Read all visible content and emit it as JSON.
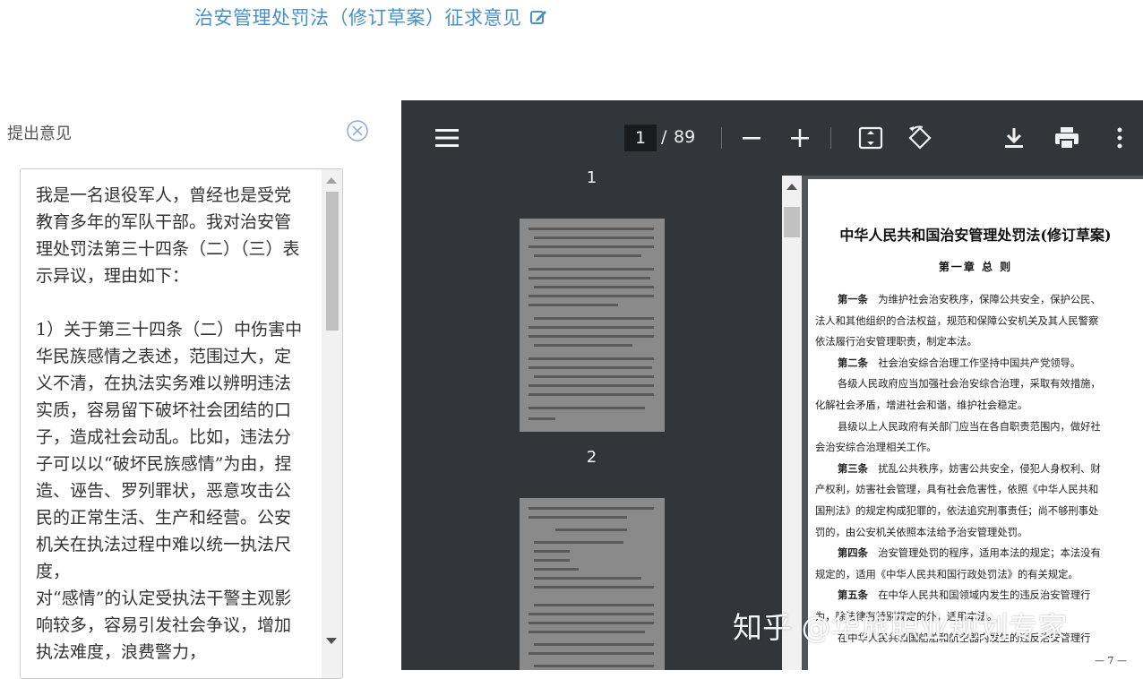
{
  "header": {
    "title": "治安管理处罚法（修订草案）征求意见",
    "edit_icon": "edit-icon"
  },
  "comment_panel": {
    "label": "提出意见",
    "close_icon": "close-circle-icon",
    "text": "我是一名退役军人，曾经也是受党教育多年的军队干部。我对治安管理处罚法第三十四条（二）（三）表示异议，理由如下：\n\n1）关于第三十四条（二）中伤害中华民族感情之表述，范围过大，定义不清，在执法实务难以辨明违法实质，容易留下破坏社会团结的口子，造成社会动乱。比如，违法分子可以以“破坏民族感情”为由，捏造、诬告、罗列罪状，恶意攻击公民的正常生活、生产和经营。公安机关在执法过程中难以统一执法尺度，\n对“感情”的认定受执法干警主观影响较多，容易引发社会争议，增加执法难度，浪费警力，"
  },
  "pdf_viewer": {
    "current_page": "1",
    "page_separator": "/",
    "total_pages": "89",
    "icons": {
      "menu": "menu-icon",
      "zoom_out": "minus-icon",
      "zoom_in": "plus-icon",
      "fit": "fit-page-icon",
      "rotate": "rotate-icon",
      "download": "download-icon",
      "print": "print-icon",
      "more": "more-vert-icon"
    },
    "thumbnails": {
      "label_1": "1",
      "label_2": "2"
    },
    "document": {
      "title": "中华人民共和国治安管理处罚法(修订草案)",
      "chapter": "第一章  总    则",
      "lines": [
        {
          "bold": "第一条",
          "text": "　为维护社会治安秩序，保障公共安全，保护公民、",
          "indent": true
        },
        {
          "bold": "",
          "text": "法人和其他组织的合法权益，规范和保障公安机关及其人民警察",
          "indent": false
        },
        {
          "bold": "",
          "text": "依法履行治安管理职责，制定本法。",
          "indent": false
        },
        {
          "bold": "第二条",
          "text": "　社会治安综合治理工作坚持中国共产党领导。",
          "indent": true
        },
        {
          "bold": "",
          "text": "各级人民政府应当加强社会治安综合治理，采取有效措施，",
          "indent": true
        },
        {
          "bold": "",
          "text": "化解社会矛盾，增进社会和谐，维护社会稳定。",
          "indent": false
        },
        {
          "bold": "",
          "text": "县级以上人民政府有关部门应当在各自职责范围内，做好社",
          "indent": true
        },
        {
          "bold": "",
          "text": "会治安综合治理相关工作。",
          "indent": false
        },
        {
          "bold": "第三条",
          "text": "　扰乱公共秩序，妨害公共安全，侵犯人身权利、财",
          "indent": true
        },
        {
          "bold": "",
          "text": "产权利，妨害社会管理，具有社会危害性，依照《中华人民共和",
          "indent": false
        },
        {
          "bold": "",
          "text": "国刑法》的规定构成犯罪的，依法追究刑事责任；尚不够刑事处",
          "indent": false
        },
        {
          "bold": "",
          "text": "罚的，由公安机关依照本法给予治安管理处罚。",
          "indent": false
        },
        {
          "bold": "第四条",
          "text": "　治安管理处罚的程序，适用本法的规定；本法没有",
          "indent": true
        },
        {
          "bold": "",
          "text": "规定的，适用《中华人民共和国行政处罚法》的有关规定。",
          "indent": false
        },
        {
          "bold": "第五条",
          "text": "　在中华人民共和国领域内发生的违反治安管理行",
          "indent": true
        },
        {
          "bold": "",
          "text": "为，除法律有特别规定的外，适用本法。",
          "indent": false
        },
        {
          "bold": "",
          "text": "在中华人民共和国船舶和航空器内发生的违反治安管理行",
          "indent": true
        }
      ],
      "footer": "— 7 —"
    }
  },
  "watermark": "知乎 @华旅职业规划专家"
}
